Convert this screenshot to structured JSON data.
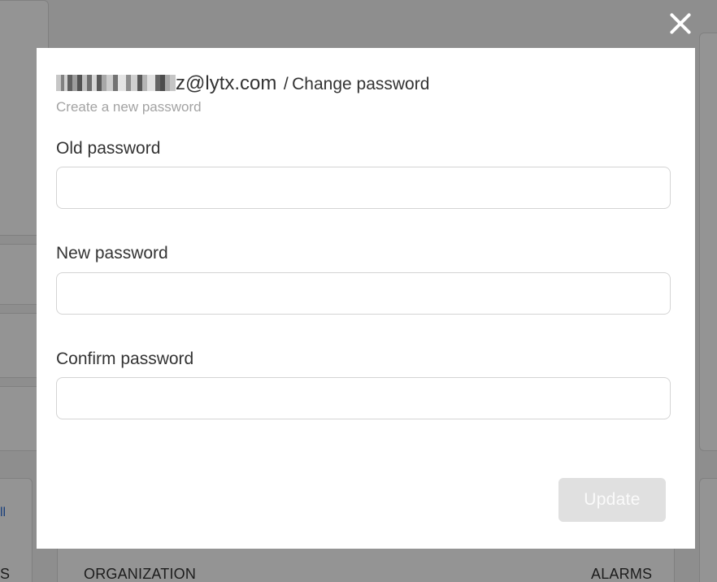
{
  "background": {
    "link_fragment": "ll",
    "left_column_fragment": "S",
    "table_headers": [
      "ORGANIZATION",
      "ALARMS"
    ]
  },
  "modal": {
    "user_email_visible": "z@lytx.com",
    "breadcrumb_separator": "/",
    "title": "Change password",
    "subtitle": "Create a new password",
    "fields": [
      {
        "label": "Old password",
        "value": "",
        "placeholder": ""
      },
      {
        "label": "New password",
        "value": "",
        "placeholder": ""
      },
      {
        "label": "Confirm password",
        "value": "",
        "placeholder": ""
      }
    ],
    "submit_label": "Update",
    "close_icon": "close-icon"
  }
}
